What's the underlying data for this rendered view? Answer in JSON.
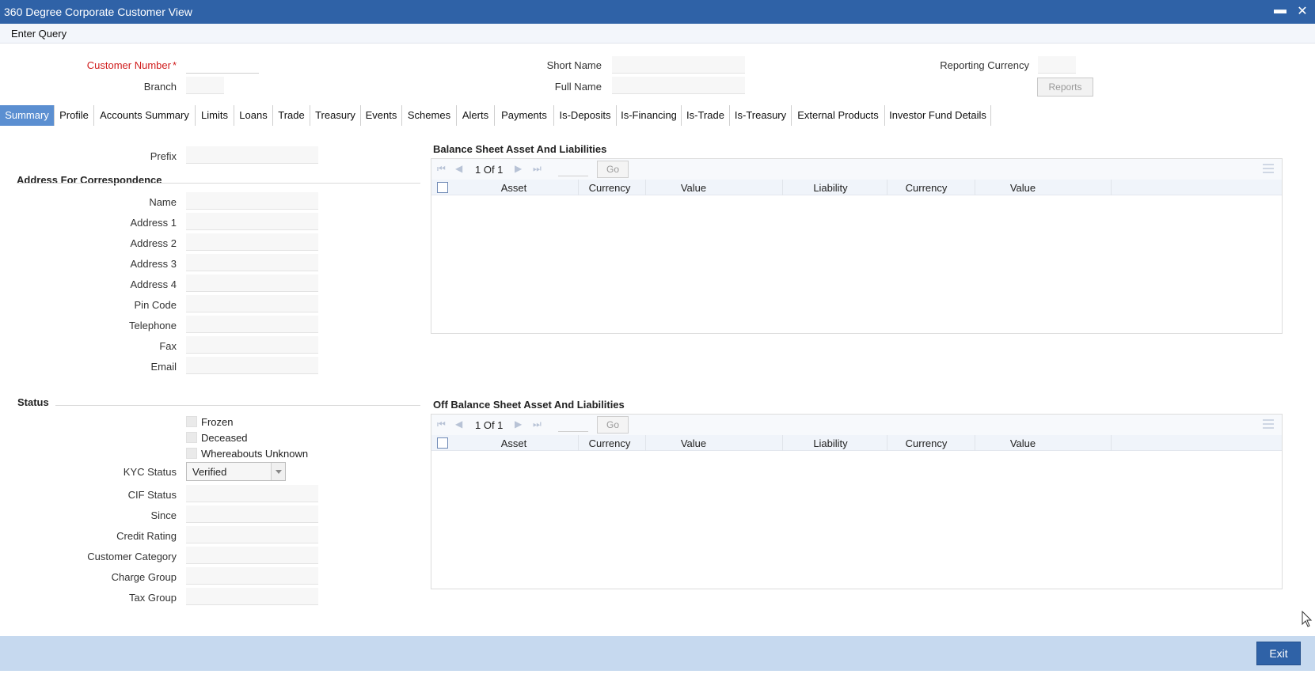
{
  "window": {
    "title": "360 Degree Corporate Customer View",
    "minimize": "▬",
    "close": "✕"
  },
  "menubar": {
    "enter_query": "Enter Query"
  },
  "header": {
    "customer_number_label": "Customer Number",
    "branch_label": "Branch",
    "short_name_label": "Short Name",
    "full_name_label": "Full Name",
    "reporting_currency_label": "Reporting Currency",
    "reports_button": "Reports"
  },
  "tabs": [
    "Summary",
    "Profile",
    "Accounts Summary",
    "Limits",
    "Loans",
    "Trade",
    "Treasury",
    "Events",
    "Schemes",
    "Alerts",
    "Payments",
    "Is-Deposits",
    "Is-Financing",
    "Is-Trade",
    "Is-Treasury",
    "External Products",
    "Investor Fund Details"
  ],
  "summary": {
    "prefix_label": "Prefix",
    "address_section": "Address For Correspondence",
    "address_fields": [
      "Name",
      "Address 1",
      "Address 2",
      "Address 3",
      "Address 4",
      "Pin Code",
      "Telephone",
      "Fax",
      "Email"
    ],
    "status_section": "Status",
    "checkboxes": [
      "Frozen",
      "Deceased",
      "Whereabouts Unknown"
    ],
    "kyc_status_label": "KYC Status",
    "kyc_status_value": "Verified",
    "status_fields": [
      "CIF Status",
      "Since",
      "Credit Rating",
      "Customer Category",
      "Charge Group",
      "Tax Group"
    ]
  },
  "balance_sheet": {
    "title": "Balance Sheet Asset And Liabilities",
    "pager": "1 Of 1",
    "go": "Go",
    "columns": [
      "Asset",
      "Currency",
      "Value",
      "Liability",
      "Currency",
      "Value"
    ]
  },
  "off_balance_sheet": {
    "title": "Off Balance Sheet Asset And Liabilities",
    "pager": "1 Of 1",
    "go": "Go",
    "columns": [
      "Asset",
      "Currency",
      "Value",
      "Liability",
      "Currency",
      "Value"
    ]
  },
  "footer": {
    "exit_label": "Exit"
  },
  "colors": {
    "title_bar": "#2f62a7",
    "active_tab": "#5b8fd1",
    "footer": "#c6d9ef",
    "required": "#d01c1c"
  }
}
